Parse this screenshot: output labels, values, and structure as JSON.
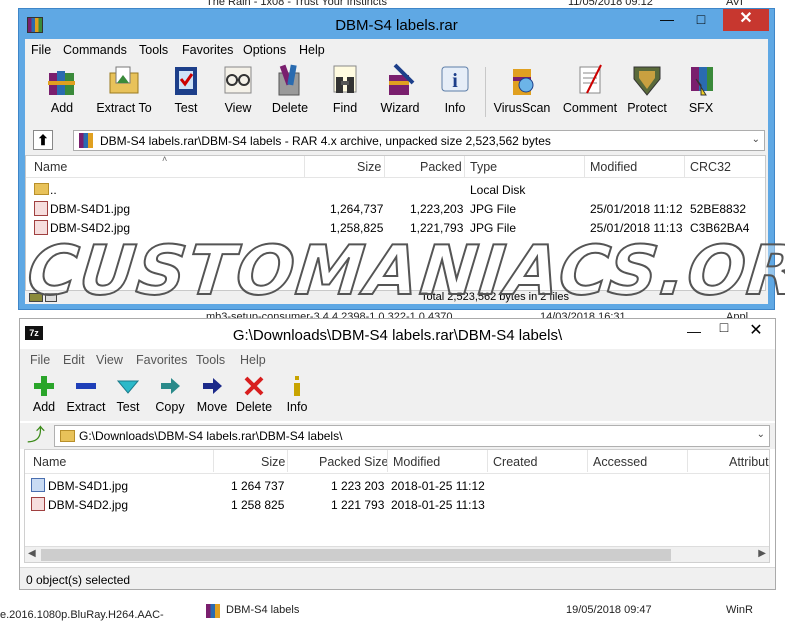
{
  "background": {
    "top_row": {
      "name": "The Rain - 1x08 - Trust Your Instincts",
      "date": "11/05/2018 09:12",
      "type": "AVI"
    },
    "middle_row": {
      "name": "mb3-setup-consumer-3.4.4.2398-1.0.322-1.0.4370",
      "date": "14/03/2018 16:31",
      "type": "Appl"
    },
    "bottom_left": "e.2016.1080p.BluRay.H264.AAC-",
    "bottom_row": {
      "name": "DBM-S4 labels",
      "date": "19/05/2018 09:47",
      "type": "WinR"
    }
  },
  "winrar": {
    "title": "DBM-S4 labels.rar",
    "menu": [
      "File",
      "Commands",
      "Tools",
      "Favorites",
      "Options",
      "Help"
    ],
    "toolbar": [
      {
        "label": "Add",
        "icon": "add-books-icon"
      },
      {
        "label": "Extract To",
        "icon": "extract-folder-icon"
      },
      {
        "label": "Test",
        "icon": "test-icon"
      },
      {
        "label": "View",
        "icon": "view-glasses-icon"
      },
      {
        "label": "Delete",
        "icon": "delete-icon"
      },
      {
        "label": "Find",
        "icon": "binoculars-icon"
      },
      {
        "label": "Wizard",
        "icon": "wizard-icon"
      },
      {
        "label": "Info",
        "icon": "info-icon"
      },
      {
        "label": "VirusScan",
        "icon": "virus-scan-icon"
      },
      {
        "label": "Comment",
        "icon": "comment-icon"
      },
      {
        "label": "Protect",
        "icon": "protect-icon"
      },
      {
        "label": "SFX",
        "icon": "sfx-icon"
      }
    ],
    "address": "DBM-S4 labels.rar\\DBM-S4 labels - RAR 4.x archive, unpacked size 2,523,562 bytes",
    "columns": [
      "Name",
      "Size",
      "Packed",
      "Type",
      "Modified",
      "CRC32"
    ],
    "rows": [
      {
        "name": "..",
        "size": "",
        "packed": "",
        "type": "Local Disk",
        "modified": "",
        "crc": ""
      },
      {
        "name": "DBM-S4D1.jpg",
        "size": "1,264,737",
        "packed": "1,223,203",
        "type": "JPG File",
        "modified": "25/01/2018 11:12",
        "crc": "52BE8832"
      },
      {
        "name": "DBM-S4D2.jpg",
        "size": "1,258,825",
        "packed": "1,221,793",
        "type": "JPG File",
        "modified": "25/01/2018 11:13",
        "crc": "C3B62BA4"
      }
    ],
    "status": "Total 2,523,562 bytes in 2 files"
  },
  "sevenzip": {
    "title": "G:\\Downloads\\DBM-S4 labels.rar\\DBM-S4 labels\\",
    "app_icon": "7z",
    "menu": [
      "File",
      "Edit",
      "View",
      "Favorites",
      "Tools",
      "Help"
    ],
    "toolbar": [
      {
        "label": "Add",
        "icon": "plus-icon",
        "color": "#2aa52a"
      },
      {
        "label": "Extract",
        "icon": "minus-icon",
        "color": "#1f3fb8"
      },
      {
        "label": "Test",
        "icon": "checkmark-icon",
        "color": "#2bb9c9"
      },
      {
        "label": "Copy",
        "icon": "copy-arrow-icon",
        "color": "#2a8a8a"
      },
      {
        "label": "Move",
        "icon": "move-arrow-icon",
        "color": "#1c2a8a"
      },
      {
        "label": "Delete",
        "icon": "delete-x-icon",
        "color": "#d81e1e"
      },
      {
        "label": "Info",
        "icon": "info-icon",
        "color": "#c8a400"
      }
    ],
    "address": "G:\\Downloads\\DBM-S4 labels.rar\\DBM-S4 labels\\",
    "columns": [
      "Name",
      "Size",
      "Packed Size",
      "Modified",
      "Created",
      "Accessed",
      "Attribut"
    ],
    "rows": [
      {
        "name": "DBM-S4D1.jpg",
        "size": "1 264 737",
        "packed": "1 223 203",
        "modified": "2018-01-25 11:12"
      },
      {
        "name": "DBM-S4D2.jpg",
        "size": "1 258 825",
        "packed": "1 221 793",
        "modified": "2018-01-25 11:13"
      }
    ],
    "status": "0 object(s) selected"
  },
  "watermark": "CUSTOMANIACS.ORG"
}
